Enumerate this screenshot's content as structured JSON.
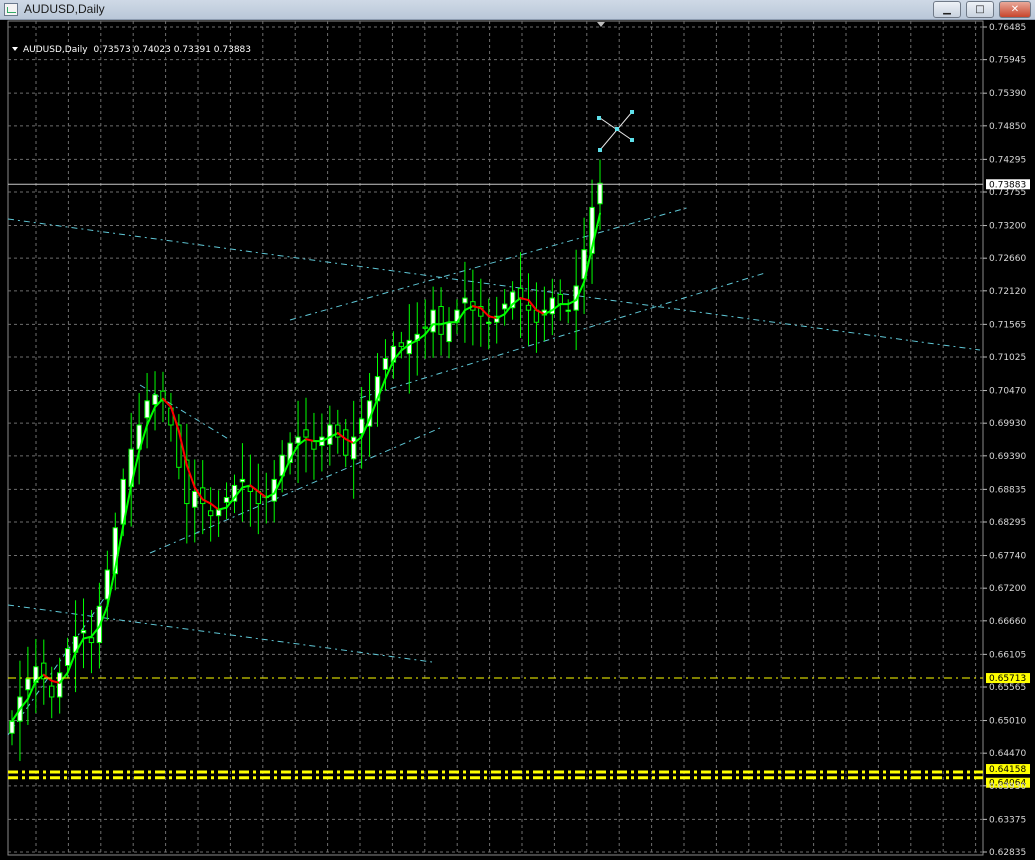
{
  "window": {
    "title": "AUDUSD,Daily",
    "buttons": {
      "minimize": "▁",
      "maximize": "□",
      "close": "✕"
    }
  },
  "chart_header": {
    "symbol_timeframe": "AUDUSD,Daily",
    "ohlc": "0.73573 0.74023 0.73391 0.73883"
  },
  "colors": {
    "background": "#000000",
    "grid": "#6e6e6e",
    "candle_outline": "#00ff00",
    "candle_body": "#ffffff",
    "ma_up": "#00ff00",
    "ma_down": "#ff0000",
    "trendline": "#5fc7d6",
    "horizontal_level": "#ffff00"
  },
  "chart_data": {
    "type": "candlestick",
    "symbol": "AUDUSD",
    "timeframe": "Daily",
    "y_ticks": [
      "0.76485",
      "0.75945",
      "0.75390",
      "0.74850",
      "0.74295",
      "0.73755",
      "0.73200",
      "0.72660",
      "0.72120",
      "0.71565",
      "0.71025",
      "0.70470",
      "0.69930",
      "0.69390",
      "0.68835",
      "0.68295",
      "0.67740",
      "0.67200",
      "0.66660",
      "0.66105",
      "0.65565",
      "0.65010",
      "0.64470",
      "0.63930",
      "0.63375",
      "0.62835"
    ],
    "ylim": [
      0.62835,
      0.76485
    ],
    "current_price": "0.73883",
    "levels": [
      {
        "label": "0.65713",
        "value": 0.65713,
        "style": "dash-dot"
      },
      {
        "label": "0.64158",
        "value": 0.64158,
        "style": "dash-dot-thick"
      },
      {
        "label": "0.64064",
        "value": 0.64064,
        "style": "dash-dot-thick"
      }
    ],
    "close_path": [
      0.65,
      0.654,
      0.657,
      0.659,
      0.657,
      0.654,
      0.658,
      0.662,
      0.664,
      0.665,
      0.663,
      0.669,
      0.675,
      0.682,
      0.69,
      0.695,
      0.699,
      0.703,
      0.704,
      0.703,
      0.699,
      0.692,
      0.686,
      0.688,
      0.686,
      0.684,
      0.685,
      0.687,
      0.689,
      0.69,
      0.688,
      0.686,
      0.687,
      0.69,
      0.694,
      0.696,
      0.697,
      0.697,
      0.695,
      0.697,
      0.699,
      0.697,
      0.694,
      0.697,
      0.7,
      0.703,
      0.707,
      0.71,
      0.712,
      0.712,
      0.713,
      0.714,
      0.715,
      0.718,
      0.714,
      0.716,
      0.718,
      0.72,
      0.718,
      0.717,
      0.716,
      0.717,
      0.719,
      0.721,
      0.72,
      0.718,
      0.716,
      0.718,
      0.72,
      0.719,
      0.718,
      0.722,
      0.728,
      0.735,
      0.739
    ]
  }
}
